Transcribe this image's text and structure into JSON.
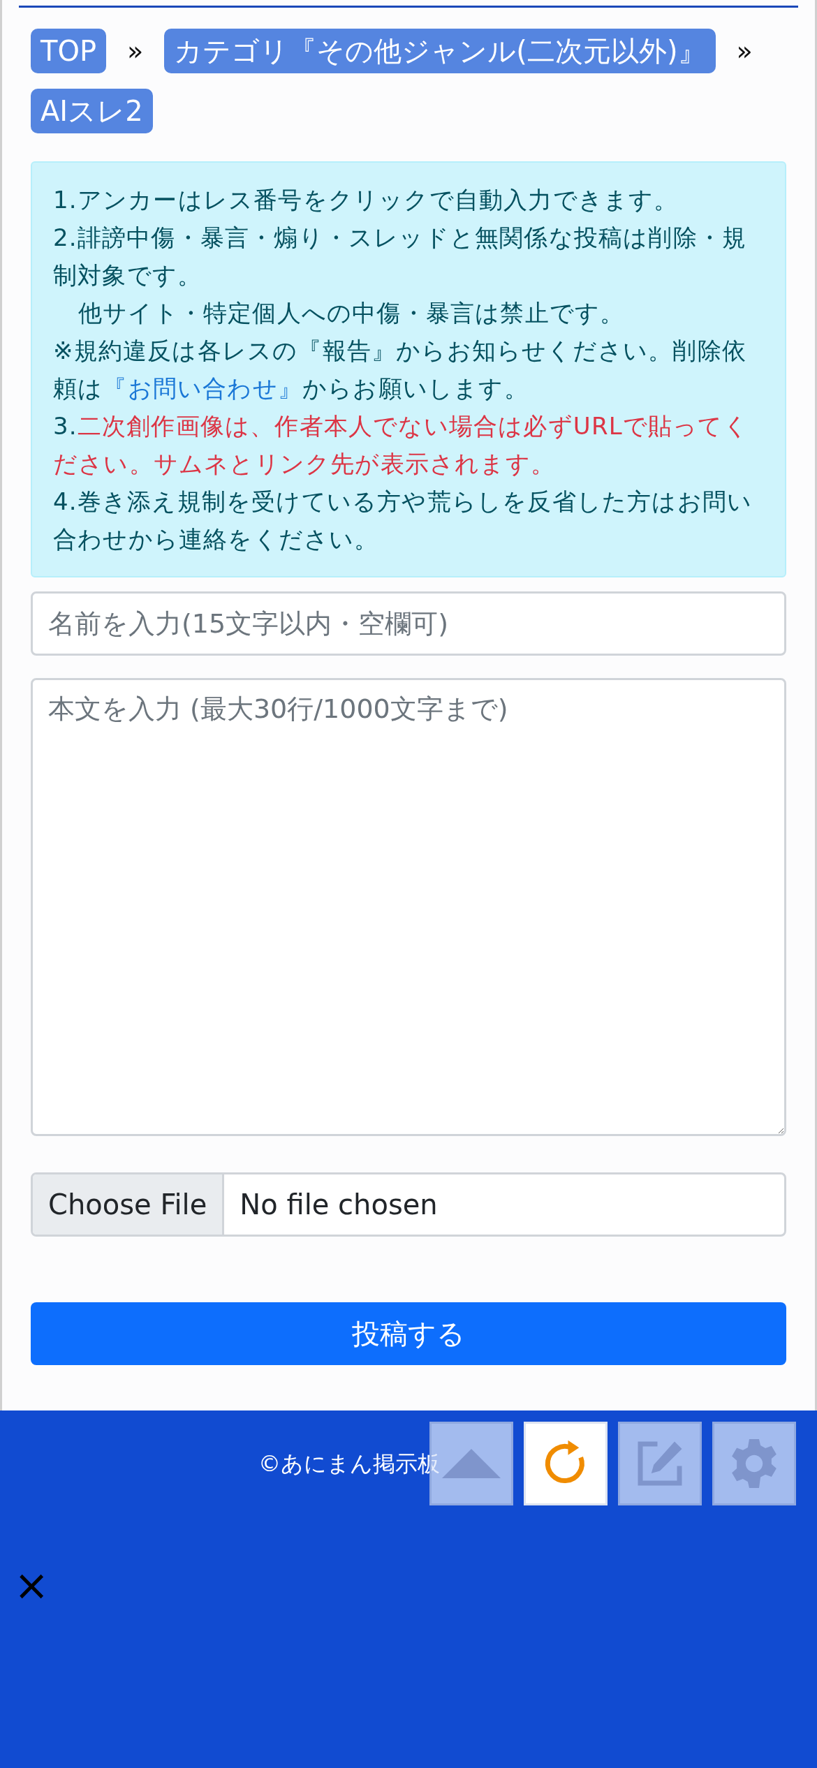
{
  "breadcrumb": {
    "items": [
      {
        "label": "TOP"
      },
      {
        "label": "カテゴリ『その他ジャンル(二次元以外)』"
      },
      {
        "label": "AIスレ2"
      }
    ],
    "separator": "»"
  },
  "notice": {
    "lines": [
      {
        "indent": false,
        "segments": [
          {
            "kind": "text",
            "text": "1.アンカーはレス番号をクリックで自動入力できます。"
          }
        ]
      },
      {
        "indent": false,
        "segments": [
          {
            "kind": "text",
            "text": "2.誹謗中傷・暴言・煽り・スレッドと無関係な投稿は削除・規制対象です。"
          }
        ]
      },
      {
        "indent": true,
        "segments": [
          {
            "kind": "text",
            "text": "他サイト・特定個人への中傷・暴言は禁止です。"
          }
        ]
      },
      {
        "indent": false,
        "segments": [
          {
            "kind": "text",
            "text": "※規約違反は各レスの『報告』からお知らせください。削除依頼は"
          },
          {
            "kind": "link",
            "text": "『お問い合わせ』"
          },
          {
            "kind": "text",
            "text": "からお願いします。"
          }
        ]
      },
      {
        "indent": false,
        "segments": [
          {
            "kind": "text",
            "text": "3."
          },
          {
            "kind": "warning",
            "text": "二次創作画像は、作者本人でない場合は必ずURLで貼ってください。サムネとリンク先が表示されます。"
          }
        ]
      },
      {
        "indent": false,
        "segments": [
          {
            "kind": "text",
            "text": "4.巻き添え規制を受けている方や荒らしを反省した方はお問い合わせから連絡をください。"
          }
        ]
      }
    ]
  },
  "form": {
    "name_field": {
      "placeholder": "名前を入力(15文字以内・空欄可)"
    },
    "body_field": {
      "placeholder": "本文を入力 (最大30行/1000文字まで)"
    },
    "file_input": {
      "button": "Choose File",
      "status": "No file chosen"
    },
    "submit": "投稿する"
  },
  "footer": {
    "copyright": "©あにまん掲示板",
    "close": "×"
  },
  "floating_buttons": [
    {
      "kind": "up",
      "active": false
    },
    {
      "kind": "reload",
      "active": true
    },
    {
      "kind": "edit",
      "active": false
    },
    {
      "kind": "settings",
      "active": false
    }
  ]
}
